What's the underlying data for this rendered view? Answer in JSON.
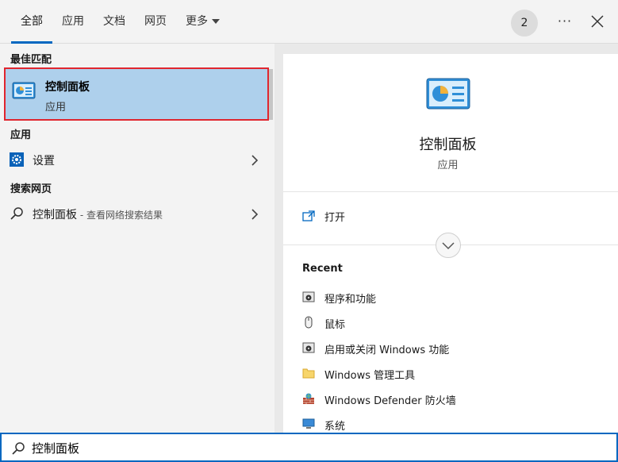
{
  "tabs": [
    {
      "label": "全部",
      "active": true
    },
    {
      "label": "应用"
    },
    {
      "label": "文档"
    },
    {
      "label": "网页"
    },
    {
      "label": "更多"
    }
  ],
  "top_actions": {
    "badge_count": "2",
    "more": "···"
  },
  "left": {
    "best_match_heading": "最佳匹配",
    "best_match": {
      "title": "控制面板",
      "subtitle": "应用",
      "icon": "control-panel-icon"
    },
    "apps_heading": "应用",
    "apps": [
      {
        "label": "设置",
        "icon": "gear-icon"
      }
    ],
    "web_heading": "搜索网页",
    "web": [
      {
        "label": "控制面板",
        "hint": " - 查看网络搜索结果",
        "icon": "search-icon"
      }
    ]
  },
  "detail": {
    "name": "控制面板",
    "type": "应用",
    "open_label": "打开",
    "recent_heading": "Recent",
    "recent": [
      {
        "label": "程序和功能",
        "icon": "programs-features-icon"
      },
      {
        "label": "鼠标",
        "icon": "mouse-icon"
      },
      {
        "label": "启用或关闭 Windows 功能",
        "icon": "windows-features-icon"
      },
      {
        "label": "Windows 管理工具",
        "icon": "folder-icon"
      },
      {
        "label": "Windows Defender 防火墙",
        "icon": "firewall-icon"
      },
      {
        "label": "系统",
        "icon": "system-monitor-icon"
      }
    ]
  },
  "search": {
    "value": "控制面板"
  },
  "colors": {
    "accent": "#0067c0",
    "selection": "#aed0ec",
    "highlight_border": "#e0262f"
  }
}
